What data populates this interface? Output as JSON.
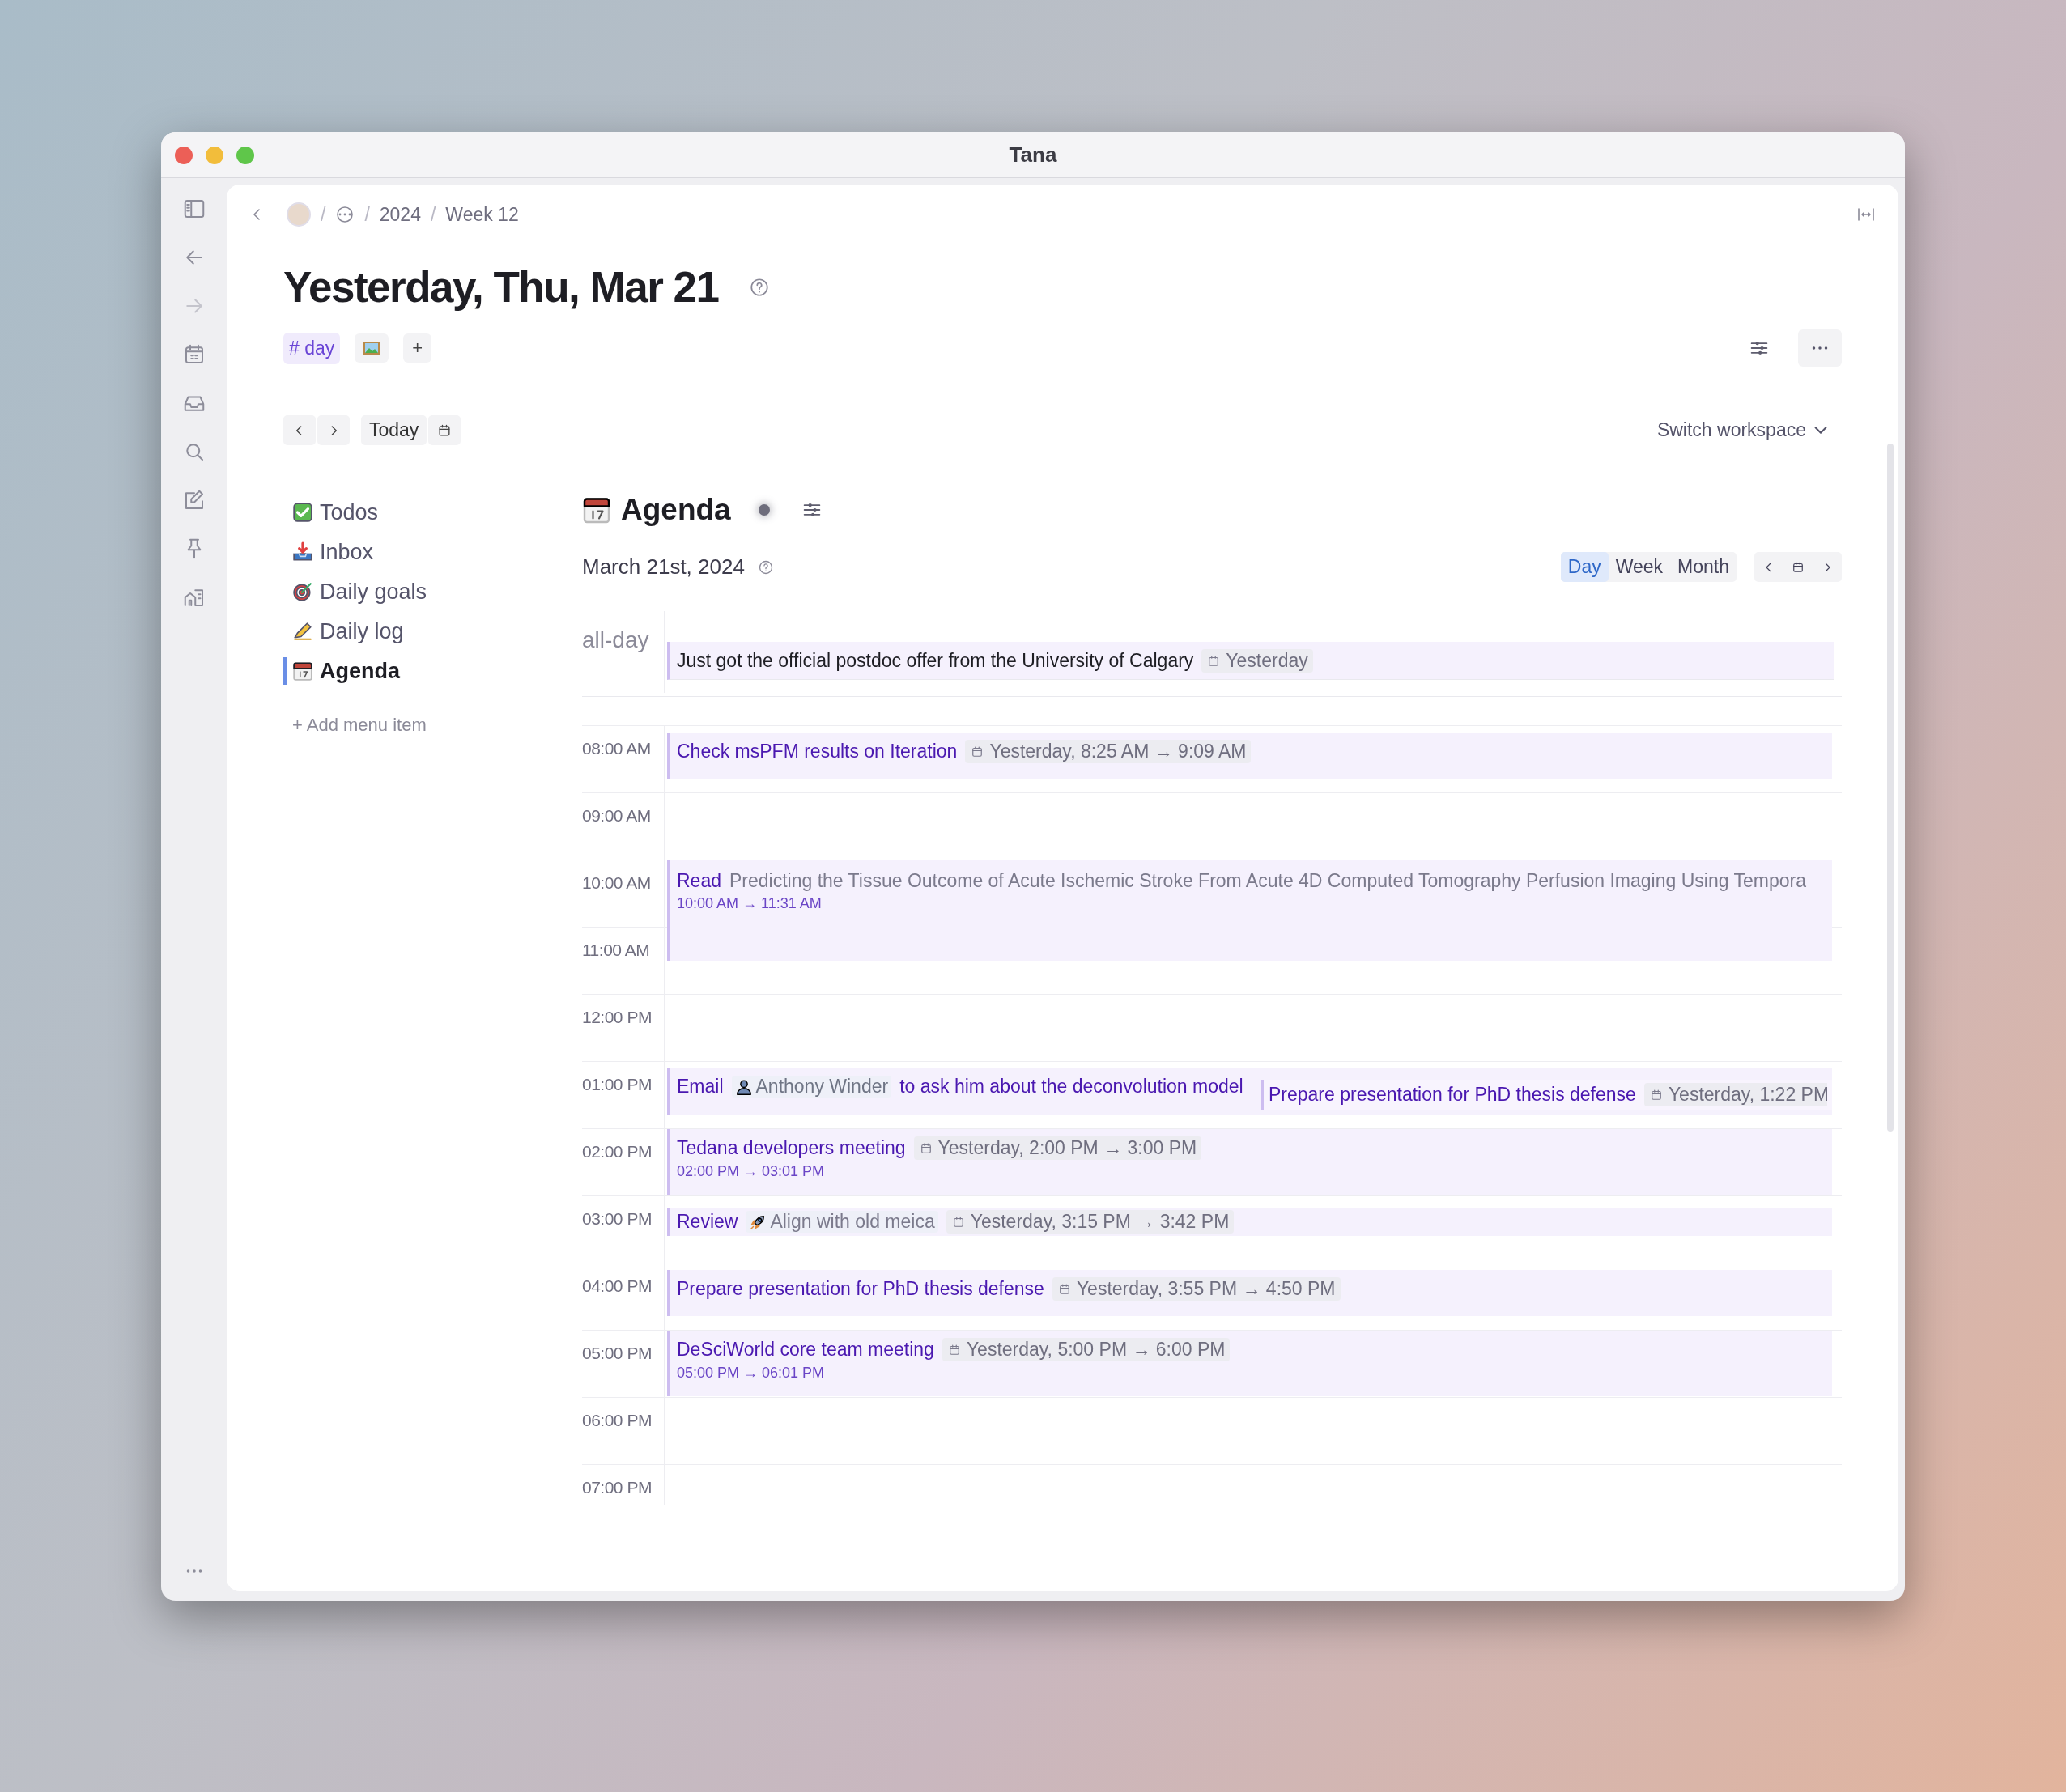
{
  "window": {
    "title": "Tana"
  },
  "breadcrumb": {
    "separator": "/",
    "items": [
      {
        "separator": "/",
        "label": "2024"
      },
      {
        "separator": "/",
        "label": "Week 12"
      }
    ]
  },
  "page": {
    "title": "Yesterday, Thu, Mar 21",
    "tag": "# day",
    "add": "+"
  },
  "nav": {
    "today": "Today",
    "switch_workspace": "Switch workspace"
  },
  "menu": {
    "items": [
      {
        "label": "Todos",
        "selected": false
      },
      {
        "label": "Inbox",
        "selected": false
      },
      {
        "label": "Daily goals",
        "selected": false
      },
      {
        "label": "Daily log",
        "selected": false
      },
      {
        "label": "Agenda",
        "selected": true
      }
    ],
    "add": "+ Add menu item"
  },
  "agenda": {
    "title": "Agenda",
    "date": "March 21st, 2024",
    "views": [
      {
        "label": "Day",
        "selected": true
      },
      {
        "label": "Week",
        "selected": false
      },
      {
        "label": "Month",
        "selected": false
      }
    ],
    "all_day": {
      "label": "all-day",
      "events": [
        {
          "kind": "allday",
          "parts": [
            {
              "kind": "plain",
              "text": "Just got the official postdoc offer from the University of Calgary"
            },
            {
              "kind": "date",
              "text": "Yesterday"
            }
          ]
        }
      ]
    },
    "hours": [
      {
        "label": "08:00 AM",
        "events": [
          {
            "kind": "event",
            "parts": [
              {
                "kind": "title",
                "text": "Check msPFM results on Iteration"
              },
              {
                "kind": "date",
                "text": "Yesterday, 8:25 AM → 9:09 AM"
              }
            ]
          }
        ]
      },
      {
        "label": "09:00 AM"
      },
      {
        "label": "10:00 AM",
        "events": [
          {
            "kind": "long",
            "parts": [
              {
                "kind": "title",
                "text": "Read"
              },
              {
                "kind": "ref",
                "text": "Predicting the Tissue Outcome of Acute Ischemic Stroke From Acute 4D Computed Tomography Perfusion Imaging Using Tempora"
              }
            ],
            "range": "10:00 AM → 11:31 AM"
          }
        ]
      },
      {
        "label": "11:00 AM"
      },
      {
        "label": "12:00 PM"
      },
      {
        "label": "01:00 PM",
        "events": [
          {
            "kind": "event",
            "parts": [
              {
                "kind": "title",
                "text": "Email"
              },
              {
                "kind": "person",
                "text": "Anthony Winder"
              },
              {
                "kind": "text",
                "text": "to ask him about the deconvolution model"
              }
            ]
          },
          {
            "kind": "overlap",
            "parts": [
              {
                "kind": "title",
                "text": "Prepare presentation for PhD thesis defense"
              },
              {
                "kind": "date",
                "text": "Yesterday, 1:22 PM"
              }
            ]
          }
        ]
      },
      {
        "label": "02:00 PM",
        "events": [
          {
            "kind": "tall",
            "parts": [
              {
                "kind": "title",
                "text": "Tedana developers meeting"
              },
              {
                "kind": "date",
                "text": "Yesterday, 2:00 PM → 3:00 PM"
              }
            ],
            "range": "02:00 PM → 03:01 PM"
          }
        ]
      },
      {
        "label": "03:00 PM",
        "events": [
          {
            "kind": "brief",
            "parts": [
              {
                "kind": "title",
                "text": "Review"
              },
              {
                "kind": "rocket",
                "text": "Align with old meica"
              },
              {
                "kind": "date",
                "text": "Yesterday, 3:15 PM → 3:42 PM"
              }
            ]
          }
        ]
      },
      {
        "label": "04:00 PM",
        "events": [
          {
            "kind": "event",
            "parts": [
              {
                "kind": "title",
                "text": "Prepare presentation for PhD thesis defense"
              },
              {
                "kind": "date",
                "text": "Yesterday, 3:55 PM → 4:50 PM"
              }
            ]
          }
        ]
      },
      {
        "label": "05:00 PM",
        "events": [
          {
            "kind": "tall",
            "parts": [
              {
                "kind": "title",
                "text": "DeSciWorld core team meeting"
              },
              {
                "kind": "date",
                "text": "Yesterday, 5:00 PM → 6:00 PM"
              }
            ],
            "range": "05:00 PM → 06:01 PM"
          }
        ]
      },
      {
        "label": "06:00 PM"
      },
      {
        "label": "07:00 PM"
      }
    ]
  }
}
